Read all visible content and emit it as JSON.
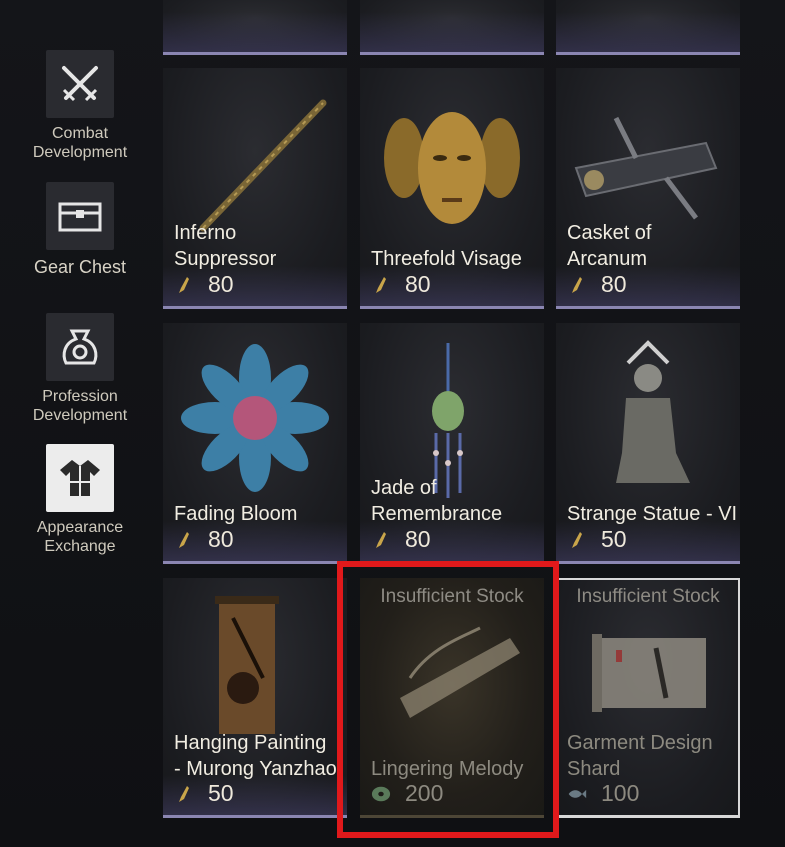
{
  "sidebar": {
    "items": [
      {
        "label": "Combat\nDevelopment",
        "icon": "crossed-swords-icon"
      },
      {
        "label": "Gear Chest",
        "icon": "chest-icon"
      },
      {
        "label": "Profession\nDevelopment",
        "icon": "money-bag-icon"
      },
      {
        "label": "Appearance\nExchange",
        "icon": "robe-icon"
      }
    ]
  },
  "shop": {
    "items": [
      {
        "name": "Inferno Suppressor",
        "line1": "Inferno",
        "line2": "Suppressor",
        "price": "80",
        "currency": "brush-token-icon"
      },
      {
        "name": "Threefold Visage",
        "price": "80",
        "currency": "brush-token-icon"
      },
      {
        "name": "Casket of Arcanum",
        "line1": "Casket of",
        "line2": "Arcanum",
        "price": "80",
        "currency": "brush-token-icon"
      },
      {
        "name": "Fading Bloom",
        "price": "80",
        "currency": "brush-token-icon"
      },
      {
        "name": "Jade of Remembrance",
        "line1": "Jade of",
        "line2": "Remembrance",
        "price": "80",
        "currency": "brush-token-icon"
      },
      {
        "name": "Strange Statue - VI",
        "price": "50",
        "currency": "brush-token-icon"
      },
      {
        "name": "Hanging Painting - Murong Yanzhao",
        "line1": "Hanging Painting",
        "line2": "- Murong Yanzhao",
        "price": "50",
        "currency": "brush-token-icon"
      },
      {
        "name": "Lingering Melody",
        "price": "200",
        "currency": "jade-coin-icon",
        "status": "Insufficient Stock"
      },
      {
        "name": "Garment Design Shard",
        "line1": "Garment Design",
        "line2": "Shard",
        "price": "100",
        "currency": "fish-token-icon",
        "status": "Insufficient Stock"
      }
    ]
  },
  "colors": {
    "highlight": "#e0191b",
    "rarity_bar": "#8b86b2"
  }
}
